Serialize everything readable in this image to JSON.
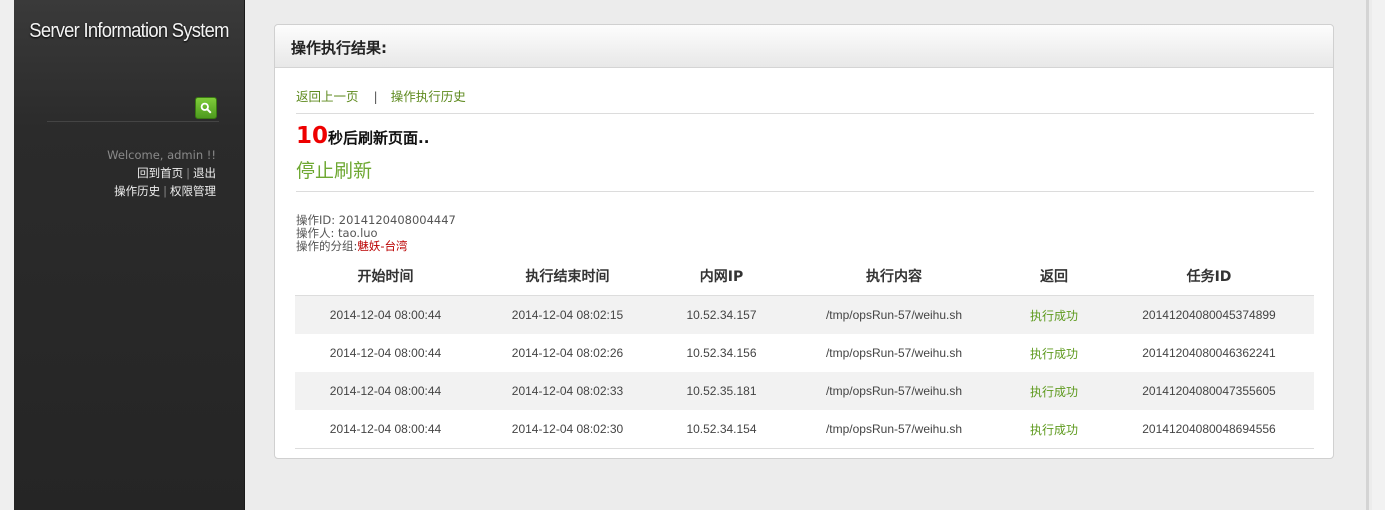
{
  "app": {
    "title": "Server Information System"
  },
  "search": {
    "placeholder": "",
    "value": ""
  },
  "sidebar": {
    "welcome": "Welcome, admin !!",
    "links": {
      "home": "回到首页",
      "logout": "退出",
      "history": "操作历史",
      "permissions": "权限管理"
    },
    "separator": "|"
  },
  "panel": {
    "title": "操作执行结果:"
  },
  "nav": {
    "back": "返回上一页",
    "separator": "|",
    "history": "操作执行历史"
  },
  "refresh": {
    "count": "10",
    "suffix": "秒后刷新页面..",
    "stop": "停止刷新"
  },
  "meta": {
    "op_id_label": "操作ID:",
    "op_id": "2014120408004447",
    "operator_label": "操作人:",
    "operator": "tao.luo",
    "group_label": "操作的分组:",
    "group": "魅妖-台湾"
  },
  "table": {
    "headers": [
      "开始时间",
      "执行结束时间",
      "内网IP",
      "执行内容",
      "返回",
      "任务ID"
    ],
    "rows": [
      [
        "2014-12-04 08:00:44",
        "2014-12-04 08:02:15",
        "10.52.34.157",
        "/tmp/opsRun-57/weihu.sh",
        "执行成功",
        "20141204080045374899"
      ],
      [
        "2014-12-04 08:00:44",
        "2014-12-04 08:02:26",
        "10.52.34.156",
        "/tmp/opsRun-57/weihu.sh",
        "执行成功",
        "20141204080046362241"
      ],
      [
        "2014-12-04 08:00:44",
        "2014-12-04 08:02:33",
        "10.52.35.181",
        "/tmp/opsRun-57/weihu.sh",
        "执行成功",
        "20141204080047355605"
      ],
      [
        "2014-12-04 08:00:44",
        "2014-12-04 08:02:30",
        "10.52.34.154",
        "/tmp/opsRun-57/weihu.sh",
        "执行成功",
        "20141204080048694556"
      ]
    ]
  },
  "colors": {
    "accent": "#5e8a1e",
    "countdown": "#ee0000",
    "group": "#bb0000",
    "search_button": "#5aaa24"
  },
  "icons": {
    "search": "search-icon"
  }
}
